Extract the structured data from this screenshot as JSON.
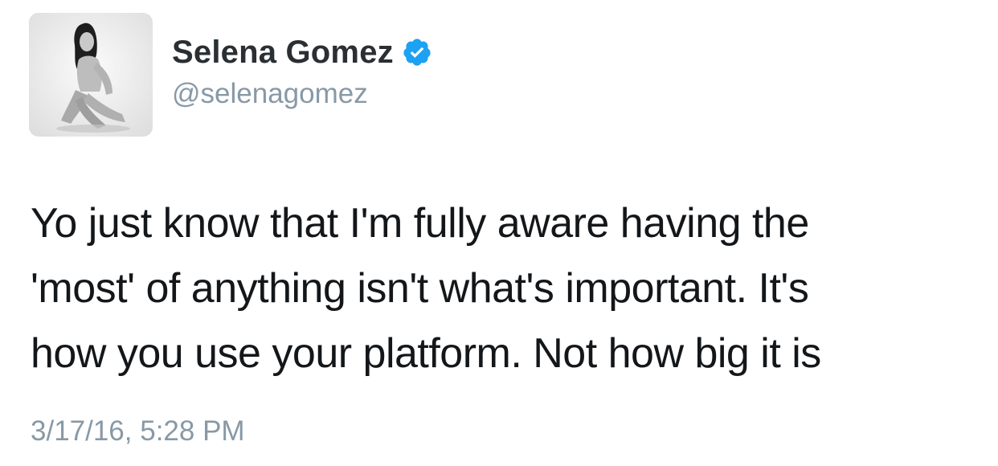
{
  "author": {
    "display_name": "Selena Gomez",
    "handle": "@selenagomez",
    "verified": true,
    "verified_color": "#1da1f2"
  },
  "tweet": {
    "text_lines": [
      "Yo just know that I'm fully aware having the",
      "'most' of anything isn't what's important. It's",
      "how you use your platform. Not how big it is"
    ],
    "timestamp": "3/17/16, 5:28 PM"
  },
  "icons": {
    "avatar": "profile-photo",
    "verified": "verified-badge-icon"
  }
}
